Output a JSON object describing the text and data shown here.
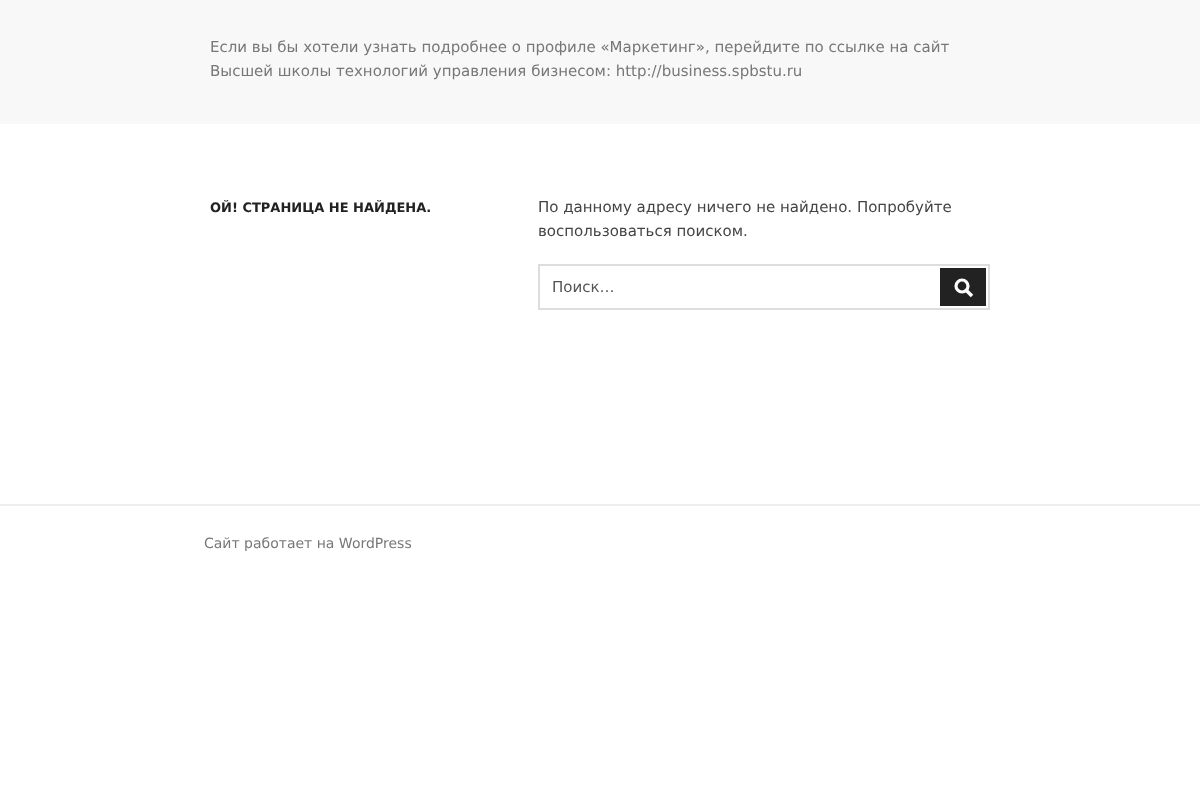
{
  "header": {
    "text": "Если вы бы хотели узнать подробнее о профиле «Маркетинг», перейдите по ссылке на сайт Высшей школы технологий управления бизнесом: http://business.spbstu.ru"
  },
  "main": {
    "title": "ОЙ! СТРАНИЦА НЕ НАЙДЕНА.",
    "message": "По данному адресу ничего не найдено. Попробуйте воспользоваться поиском.",
    "search": {
      "placeholder": "Поиск…"
    }
  },
  "footer": {
    "text": "Сайт работает на WordPress"
  }
}
